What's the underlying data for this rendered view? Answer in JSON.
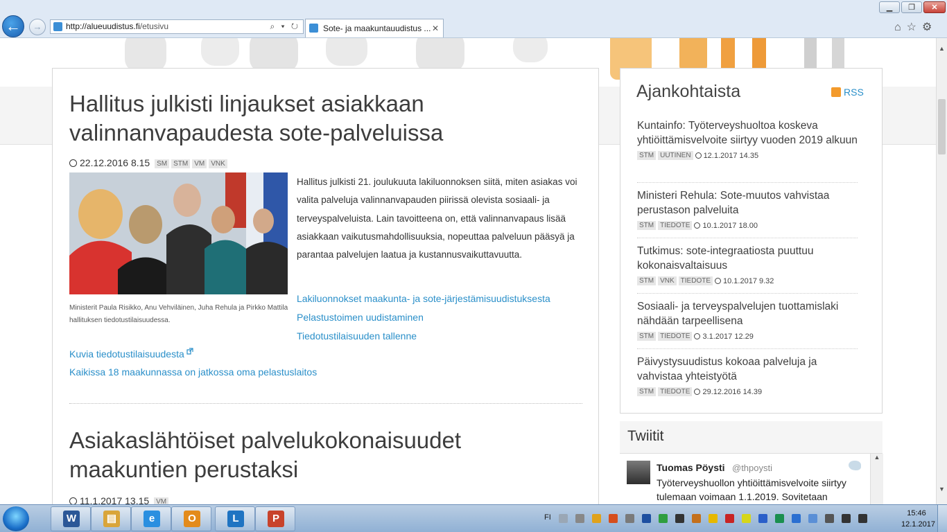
{
  "browser": {
    "url_host": "http://alueuudistus.fi",
    "url_path": "/etusivu",
    "tab_title": "Sote- ja maakuntauudistus ...",
    "address_tools": "⌕ ▾ ↻",
    "tab_close": "✕",
    "right_tools": "⌂☆⚙",
    "window_buttons": {
      "minimize": "▁",
      "maximize": "❐",
      "close": "✕"
    },
    "back": "←",
    "forward": "→"
  },
  "main_article": {
    "title_line1": "Hallitus julkisti linjaukset asiakkaan",
    "title_line2": "valinnanvapaudesta sote-palveluissa",
    "date": "22.12.2016 8.15",
    "tags": [
      "SM",
      "STM",
      "VM",
      "VNK"
    ],
    "photo_caption": "Ministerit Paula Risikko, Anu Vehviläinen, Juha Rehula ja Pirkko Mattila hallituksen tiedotustilaisuudessa.",
    "body": "Hallitus julkisti 21. joulukuuta lakiluonnoksen siitä, miten asiakas voi valita palveluja valinnanvapauden piirissä olevista sosiaali- ja terveyspalveluista. Lain tavoitteena on, että valinnanvapaus lisää asiakkaan vaikutusmahdollisuuksia, nopeuttaa palveluun pääsyä ja parantaa palvelujen laatua ja kustannusvaikuttavuutta.",
    "links": [
      "Lakiluonnokset maakunta- ja sote-järjestämisuudistuksesta",
      "Pelastustoimen uudistaminen",
      "Tiedotustilaisuuden tallenne"
    ],
    "bottom_links": [
      "Kuvia tiedotustilaisuudesta",
      "Kaikissa 18 maakunnassa on jatkossa oma pelastuslaitos"
    ]
  },
  "second_article": {
    "title_line1": "Asiakaslähtöiset palvelukokonaisuudet",
    "title_line2": "maakuntien perustaksi",
    "date": "11.1.2017 13.15",
    "tags": [
      "VM"
    ]
  },
  "sidebar": {
    "title": "Ajankohtaista",
    "rss": "RSS",
    "items": [
      {
        "title": "Kuntainfo: Työterveyshuoltoa koskeva yhtiöittämisvelvoite siirtyy vuoden 2019 alkuun",
        "tags": [
          "STM",
          "UUTINEN"
        ],
        "date": "12.1.2017 14.35"
      },
      {
        "title": "Ministeri Rehula: Sote-muutos vahvistaa perustason palveluita",
        "tags": [
          "STM",
          "TIEDOTE"
        ],
        "date": "10.1.2017 18.00"
      },
      {
        "title": "Tutkimus: sote-integraatiosta puuttuu kokonaisvaltaisuus",
        "tags": [
          "STM",
          "VNK",
          "TIEDOTE"
        ],
        "date": "10.1.2017 9.32"
      },
      {
        "title": "Sosiaali- ja terveyspalvelujen tuottamislaki nähdään tarpeellisena",
        "tags": [
          "STM",
          "TIEDOTE"
        ],
        "date": "3.1.2017 12.29"
      },
      {
        "title": "Päivystysuudistus kokoaa palveluja ja vahvistaa yhteistyötä",
        "tags": [
          "STM",
          "TIEDOTE"
        ],
        "date": "29.12.2016 14.39"
      }
    ]
  },
  "twitter": {
    "title": "Twiitit",
    "name": "Tuomas Pöysti",
    "handle": "@thpoysti",
    "text": "Työterveyshuollon yhtiöittämisvelvoite siirtyy tulemaan voimaan 1.1.2019. Sovitetaan"
  },
  "taskbar": {
    "apps": [
      {
        "name": "word",
        "glyph": "W",
        "color": "#2b5797"
      },
      {
        "name": "explorer",
        "glyph": "▤",
        "color": "#d9a53a"
      },
      {
        "name": "internet-explorer",
        "glyph": "e",
        "color": "#2a8fe0"
      },
      {
        "name": "outlook",
        "glyph": "O",
        "color": "#e38b1c"
      },
      {
        "name": "lync",
        "glyph": "L",
        "color": "#1f74c2"
      },
      {
        "name": "powerpoint",
        "glyph": "P",
        "color": "#c8432b"
      }
    ],
    "language": "FI",
    "time": "15:46",
    "date": "12.1.2017",
    "tray_colors": [
      "#9aa7b5",
      "#888888",
      "#e0a21c",
      "#d64e1c",
      "#7a7a7a",
      "#1d4fa0",
      "#2f9e3f",
      "#333333",
      "#c4701c",
      "#e6b800",
      "#c82424",
      "#d6d61a",
      "#2a5fc9",
      "#1a8f4f",
      "#2a6fd1",
      "#5a8fd6",
      "#555555",
      "#333333",
      "#333333"
    ]
  },
  "scrollbar": {
    "up": "▲",
    "down": "▼"
  },
  "tweet_scroll": {
    "up": "▲"
  }
}
